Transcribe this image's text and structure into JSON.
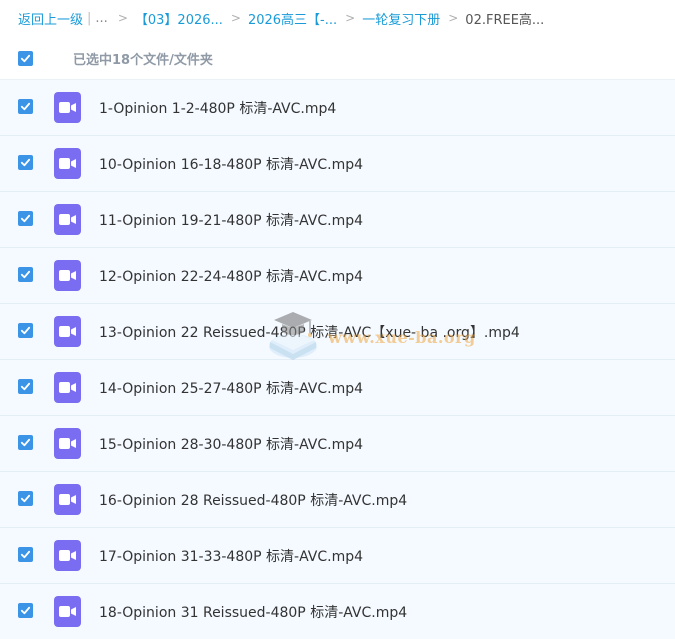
{
  "breadcrumb": {
    "back_label": "返回上一级",
    "pipe": "|",
    "ellipsis": "...",
    "separator": ">",
    "items": [
      {
        "label": "【03】2026..."
      },
      {
        "label": "2026高三【-..."
      },
      {
        "label": "一轮复习下册"
      }
    ],
    "current": "02.FREE高..."
  },
  "selection": {
    "label": "已选中18个文件/文件夹",
    "checked": true
  },
  "files": [
    {
      "name": "1-Opinion 1-2-480P 标清-AVC.mp4",
      "checked": true
    },
    {
      "name": "10-Opinion 16-18-480P 标清-AVC.mp4",
      "checked": true
    },
    {
      "name": "11-Opinion 19-21-480P 标清-AVC.mp4",
      "checked": true
    },
    {
      "name": "12-Opinion 22-24-480P 标清-AVC.mp4",
      "checked": true
    },
    {
      "name": "13-Opinion 22 Reissued-480P 标清-AVC【xue- ba .org】.mp4",
      "checked": true
    },
    {
      "name": "14-Opinion 25-27-480P 标清-AVC.mp4",
      "checked": true
    },
    {
      "name": "15-Opinion 28-30-480P 标清-AVC.mp4",
      "checked": true
    },
    {
      "name": "16-Opinion 28 Reissued-480P 标清-AVC.mp4",
      "checked": true
    },
    {
      "name": "17-Opinion 31-33-480P 标清-AVC.mp4",
      "checked": true
    },
    {
      "name": "18-Opinion 31 Reissued-480P 标清-AVC.mp4",
      "checked": true
    }
  ],
  "icons": {
    "checkbox": "checkbox-checked-icon",
    "file": "video-file-icon"
  },
  "watermark": {
    "text": "www.xue-ba.org"
  },
  "colors": {
    "link": "#1a9bd8",
    "checkbox": "#3c94e6",
    "video_icon": "#7b6df1",
    "row_background": "#f4faff",
    "watermark": "#f0a742"
  }
}
